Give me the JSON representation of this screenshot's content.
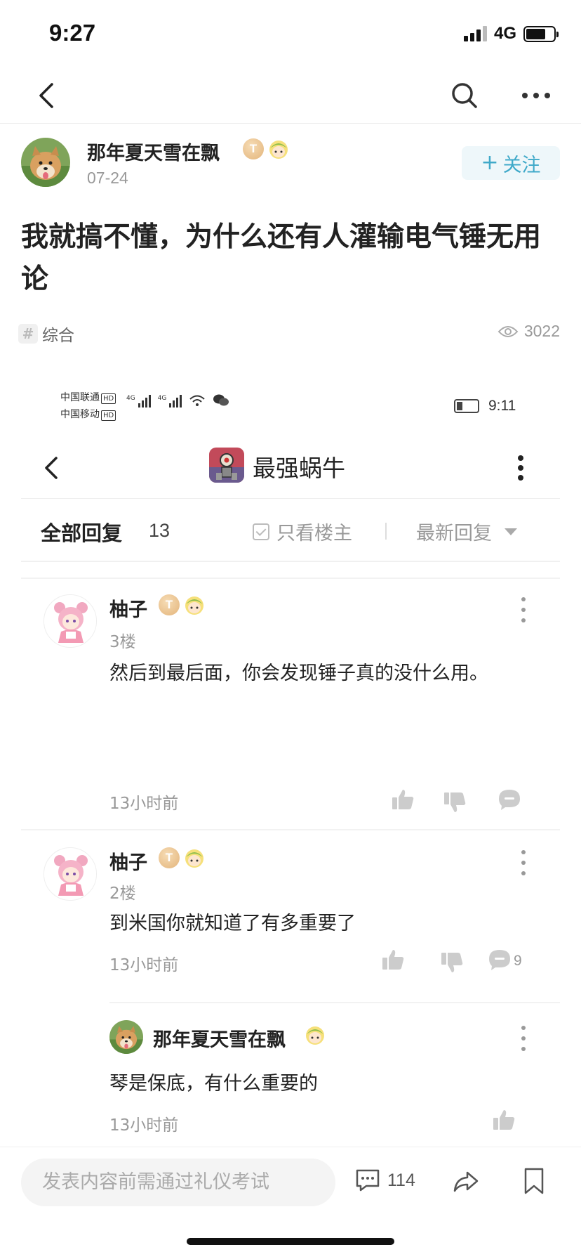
{
  "status_bar": {
    "time": "9:27",
    "network": "4G"
  },
  "post": {
    "author": "那年夏天雪在飘",
    "author_badge": "T",
    "date": "07-24",
    "follow_label": "关注",
    "title": "我就搞不懂，为什么还有人灌输电气锤无用论",
    "topic": "综合",
    "views": "3022"
  },
  "screenshot": {
    "carrier_1": "中国联通",
    "carrier_2": "中国移动",
    "hd": "HD",
    "time": "9:11",
    "title": "最强蜗牛",
    "replies_label": "全部回复",
    "replies_count": "13",
    "only_owner_label": "只看楼主",
    "sort_label": "最新回复",
    "comments": [
      {
        "user": "柚子",
        "badge": "T",
        "floor": "3楼",
        "text": "然后到最后面，你会发现锤子真的没什么用。",
        "time": "13小时前"
      },
      {
        "user": "柚子",
        "badge": "T",
        "floor": "2楼",
        "text": "到米国你就知道了有多重要了",
        "time": "13小时前",
        "reply_count": "9"
      }
    ],
    "sub_reply": {
      "user": "那年夏天雪在飘",
      "text": "琴是保底，有什么重要的",
      "time": "13小时前"
    }
  },
  "bottom_bar": {
    "compose_placeholder": "发表内容前需通过礼仪考试",
    "comment_count": "114"
  },
  "colors": {
    "accent": "#3fa9c9",
    "badge_gold": "#e3b47a",
    "muted": "#999999"
  }
}
